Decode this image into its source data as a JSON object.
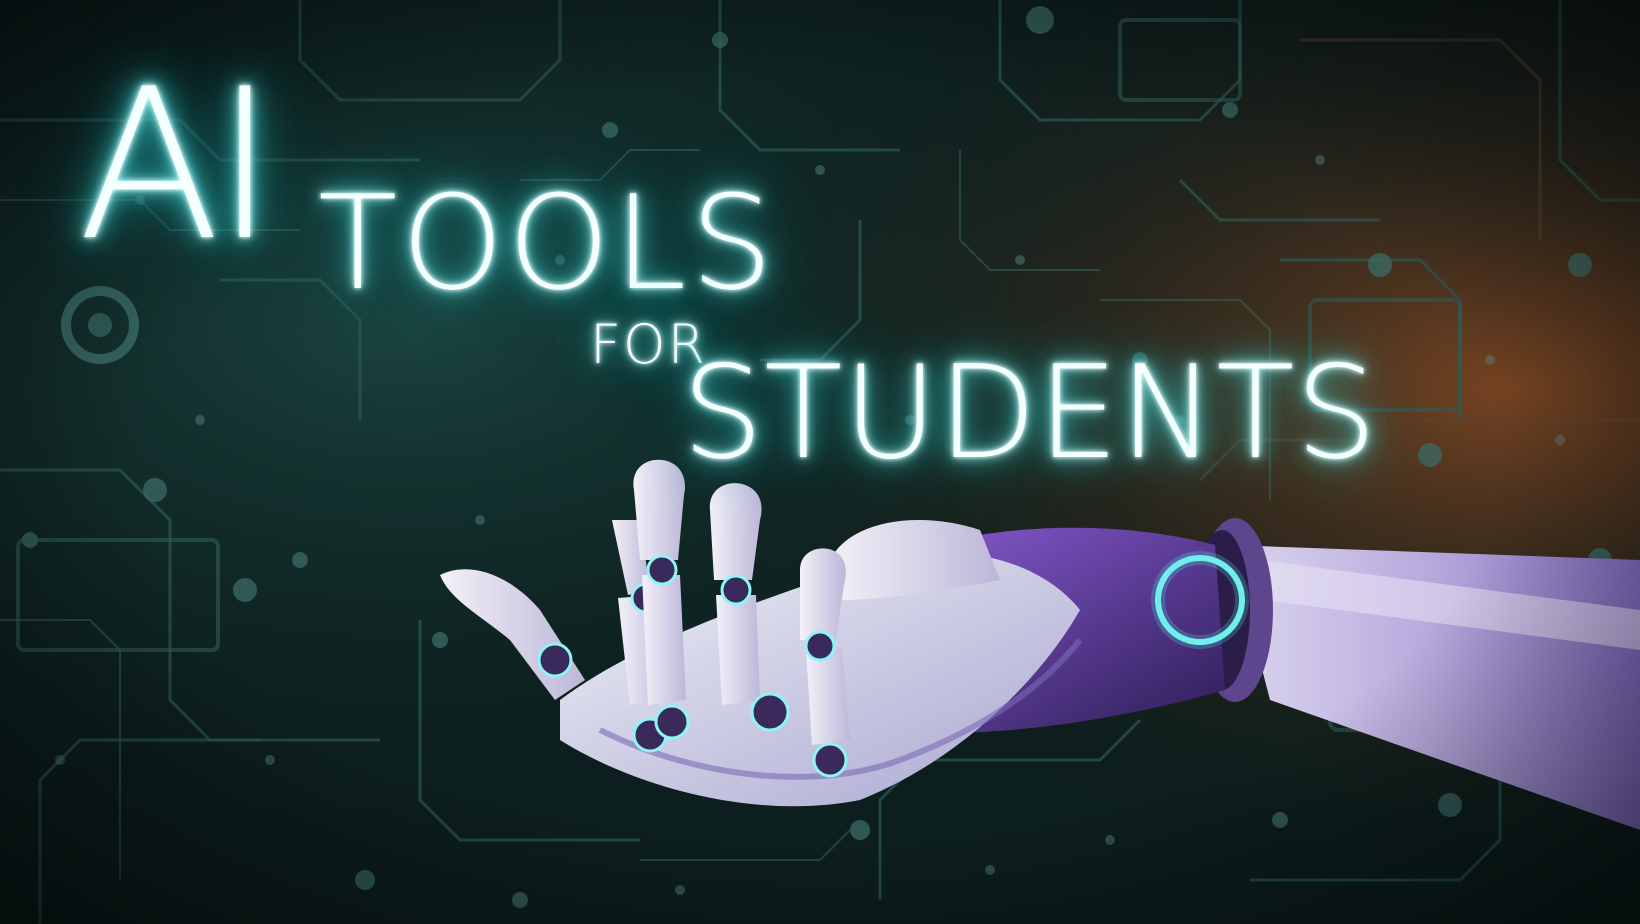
{
  "title": {
    "line1": "AI",
    "line2": "TOOLS",
    "line3": "FOR",
    "line4": "STUDENTS"
  },
  "colors": {
    "glow": "#4fe0e0",
    "text": "#f4ffff",
    "board_dark": "#0b1c1b",
    "board_warm": "#6a3a1c",
    "hand_white": "#e9e4f2",
    "hand_purple": "#7a4fc0"
  }
}
